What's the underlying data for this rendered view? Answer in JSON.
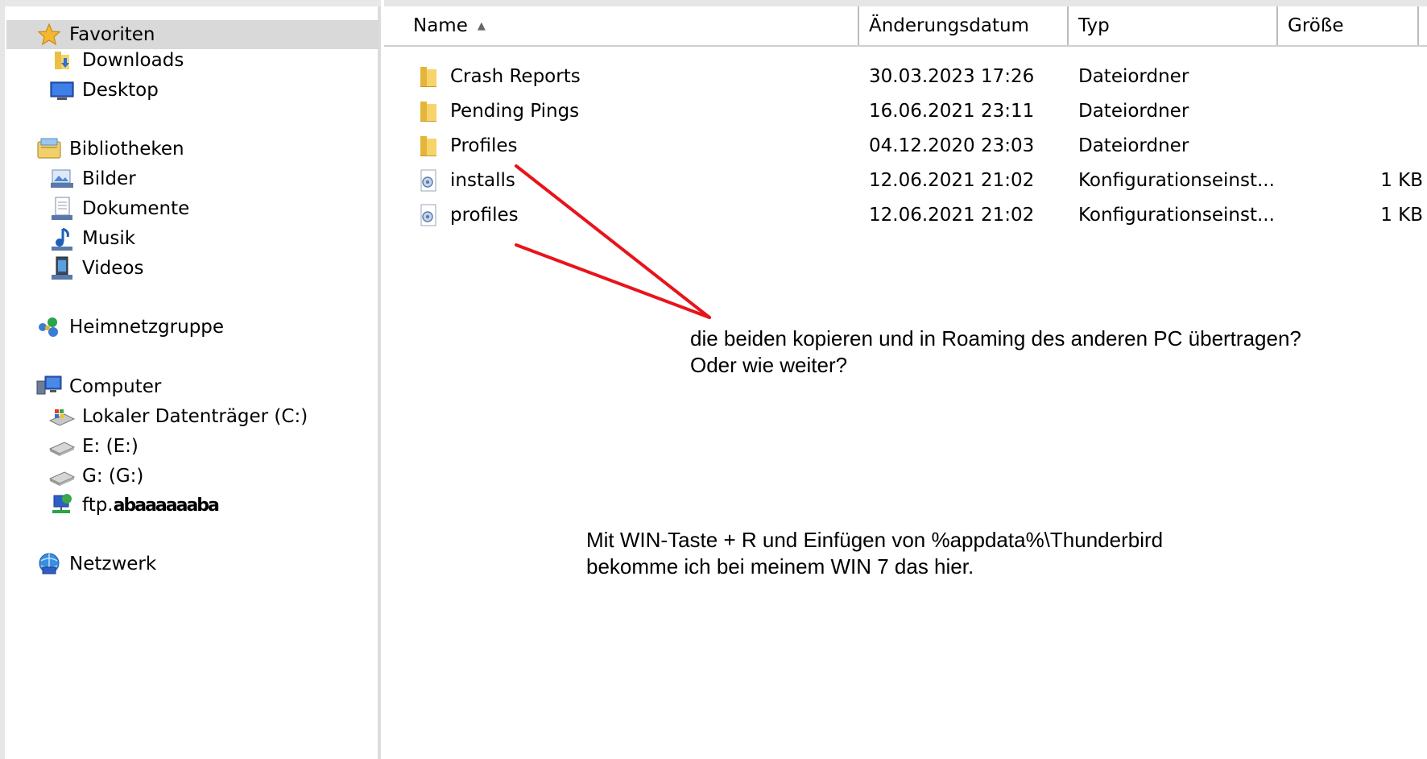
{
  "nav": {
    "favorites": {
      "label": "Favoriten",
      "icon": "star-icon"
    },
    "favorite_items": [
      {
        "label": "Downloads",
        "icon": "downloads-folder-icon"
      },
      {
        "label": "Desktop",
        "icon": "desktop-icon"
      }
    ],
    "libraries": {
      "label": "Bibliotheken",
      "icon": "libraries-icon"
    },
    "library_items": [
      {
        "label": "Bilder",
        "icon": "pictures-icon"
      },
      {
        "label": "Dokumente",
        "icon": "documents-icon"
      },
      {
        "label": "Musik",
        "icon": "music-icon"
      },
      {
        "label": "Videos",
        "icon": "videos-icon"
      }
    ],
    "homegroup": {
      "label": "Heimnetzgruppe",
      "icon": "homegroup-icon"
    },
    "computer": {
      "label": "Computer",
      "icon": "computer-icon"
    },
    "computer_items": [
      {
        "label": "Lokaler Datenträger (C:)",
        "icon": "local-disk-icon"
      },
      {
        "label": "E: (E:)",
        "icon": "drive-icon"
      },
      {
        "label": "G: (G:)",
        "icon": "drive-icon"
      },
      {
        "label": "ftp.",
        "label_obscured": "abaaaaaaba",
        "icon": "network-location-icon"
      }
    ],
    "network": {
      "label": "Netzwerk",
      "icon": "network-icon"
    }
  },
  "columns": {
    "name": "Name",
    "date": "Änderungsdatum",
    "type": "Typ",
    "size": "Größe",
    "sort_icon": "sort-ascending-icon"
  },
  "files": [
    {
      "name": "Crash Reports",
      "date": "30.03.2023 17:26",
      "type": "Dateiordner",
      "size": "",
      "icon": "folder-icon"
    },
    {
      "name": "Pending Pings",
      "date": "16.06.2021 23:11",
      "type": "Dateiordner",
      "size": "",
      "icon": "folder-icon"
    },
    {
      "name": "Profiles",
      "date": "04.12.2020 23:03",
      "type": "Dateiordner",
      "size": "",
      "icon": "folder-icon"
    },
    {
      "name": "installs",
      "date": "12.06.2021 21:02",
      "type": "Konfigurationseinst...",
      "size": "1 KB",
      "icon": "config-file-icon"
    },
    {
      "name": "profiles",
      "date": "12.06.2021 21:02",
      "type": "Konfigurationseinst...",
      "size": "1 KB",
      "icon": "config-file-icon"
    }
  ],
  "annotations": {
    "note1_line1": "die beiden kopieren und in Roaming des anderen PC übertragen?",
    "note1_line2": "Oder wie weiter?",
    "note2_line1": "Mit WIN-Taste + R und Einfügen von %appdata%\\Thunderbird",
    "note2_line2": "bekomme ich bei meinem WIN 7 das hier.",
    "arrow_color": "#e8141b"
  },
  "colors": {
    "folder": "#f2c94c",
    "selection": "#d9d9d9"
  }
}
